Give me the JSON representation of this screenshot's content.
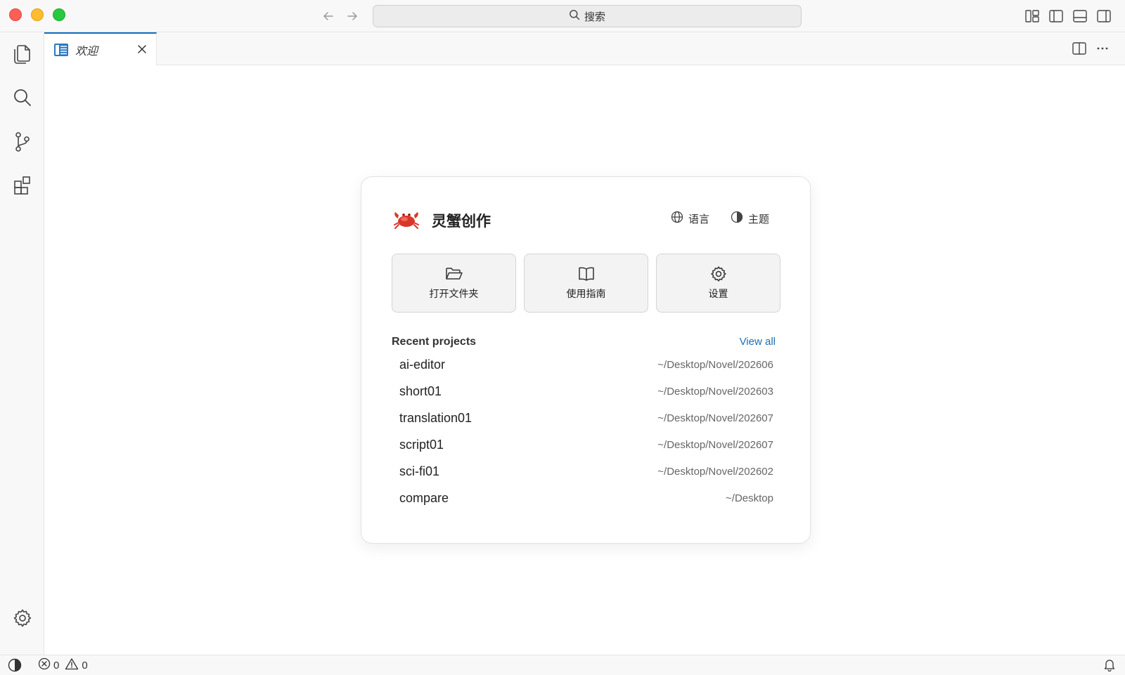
{
  "titlebar": {
    "search_label": "搜索",
    "icons": [
      "back-arrow-icon",
      "forward-arrow-icon",
      "search-icon",
      "customize-layout-icon",
      "toggle-primary-sidebar-icon",
      "toggle-panel-icon",
      "toggle-secondary-sidebar-icon"
    ]
  },
  "activity_bar": {
    "items": [
      "explorer-icon",
      "search-icon",
      "source-control-icon",
      "extensions-icon"
    ],
    "bottom": "settings-gear-icon"
  },
  "tabs": [
    {
      "label": "欢迎",
      "icon": "welcome-icon",
      "active": true
    }
  ],
  "welcome": {
    "app_name": "灵蟹创作",
    "logo": "crab-emoji-icon",
    "language_label": "语言",
    "theme_label": "主题",
    "quick_actions": [
      {
        "label": "打开文件夹",
        "icon": "folder-open-icon"
      },
      {
        "label": "使用指南",
        "icon": "book-icon"
      },
      {
        "label": "设置",
        "icon": "gear-icon"
      }
    ],
    "recent_title": "Recent projects",
    "view_all": "View all",
    "projects": [
      {
        "name": "ai-editor",
        "path": "~/Desktop/Novel/202606"
      },
      {
        "name": "short01",
        "path": "~/Desktop/Novel/202603"
      },
      {
        "name": "translation01",
        "path": "~/Desktop/Novel/202607"
      },
      {
        "name": "script01",
        "path": "~/Desktop/Novel/202607"
      },
      {
        "name": "sci-fi01",
        "path": "~/Desktop/Novel/202602"
      },
      {
        "name": "compare",
        "path": "~/Desktop"
      }
    ]
  },
  "statusbar": {
    "errors": "0",
    "warnings": "0"
  },
  "colors": {
    "accent": "#0e6fc0",
    "link": "#1a6fb8",
    "close": "#ff5f57",
    "minimize": "#febc2e",
    "maximize": "#28c840"
  }
}
